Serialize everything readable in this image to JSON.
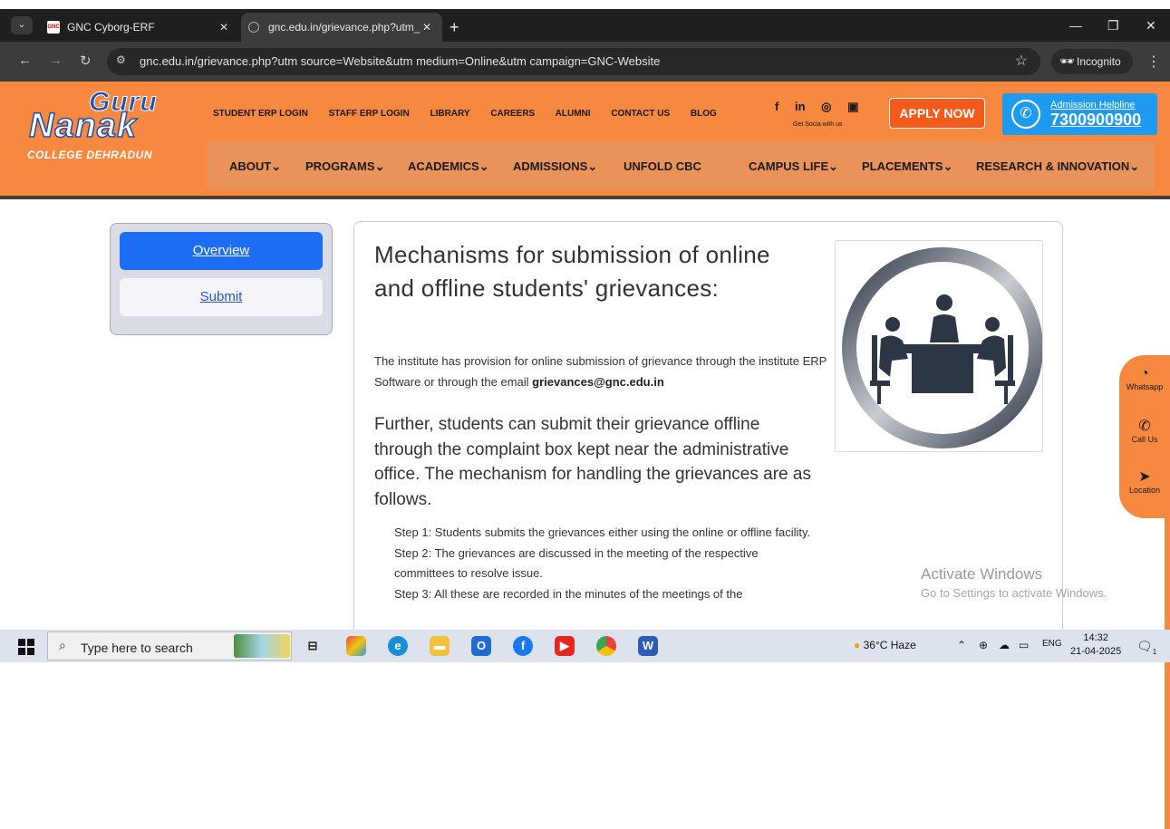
{
  "browser": {
    "tabs": [
      {
        "title": "GNC Cyborg-ERF",
        "favicon": "GNC"
      },
      {
        "title": "gnc.edu.in/grievance.php?utm_"
      }
    ],
    "new_tab": "+",
    "url": "gnc.edu.in/grievance.php?utm source=Website&utm medium=Online&utm campaign=GNC-Website",
    "incognito_label": "Incognito"
  },
  "site": {
    "logo": {
      "guru": "Guru",
      "nanak": "Nanak",
      "college": "COLLEGE DEHRADUN"
    },
    "top_links": [
      "STUDENT ERP LOGIN",
      "STAFF ERP LOGIN",
      "LIBRARY",
      "CAREERS",
      "ALUMNI",
      "CONTACT US",
      "BLOG"
    ],
    "social": {
      "icons": [
        "facebook-icon",
        "linkedin-icon",
        "instagram-icon",
        "youtube-icon"
      ],
      "tagline": "Get Socia with us"
    },
    "apply_label": "APPLY NOW",
    "helpline": {
      "label": "Admission Helpline",
      "number": "7300900900"
    },
    "nav": [
      "ABOUT",
      "PROGRAMS",
      "ACADEMICS",
      "ADMISSIONS",
      "UNFOLD CBC",
      "CAMPUS LIFE",
      "PLACEMENTS",
      "RESEARCH & INNOVATION"
    ]
  },
  "sidebar": {
    "items": [
      {
        "label": "Overview",
        "active": true
      },
      {
        "label": "Submit",
        "active": false
      }
    ]
  },
  "main": {
    "title": "Mechanisms for submission of online and offline students' grievances:",
    "para1_text": "The institute has provision for online submission of grievance through the institute ERP Software or through the email ",
    "para1_email": "grievances@gnc.edu.in",
    "para2": "Further, students can submit their grievance offline through the complaint box kept near the administrative office. The mechanism for handling the grievances are as follows.",
    "steps": [
      "Step 1: Students submits the grievances either using the online or offline facility.",
      "Step 2: The grievances are discussed in the meeting of the respective committees to resolve issue.",
      "Step 3: All these are recorded in the minutes of the meetings of the"
    ]
  },
  "floating_contact": [
    {
      "icon": "whatsapp-icon",
      "label": "Whatsapp"
    },
    {
      "icon": "phone-icon",
      "label": "Call Us"
    },
    {
      "icon": "location-icon",
      "label": "Location"
    }
  ],
  "watermark": {
    "line1": "Activate Windows",
    "line2": "Go to Settings to activate Windows."
  },
  "taskbar": {
    "search_placeholder": "Type here to search",
    "weather": "36°C Haze",
    "language": "ENG",
    "time": "14:32",
    "date": "21-04-2025",
    "notification_count": "1"
  }
}
